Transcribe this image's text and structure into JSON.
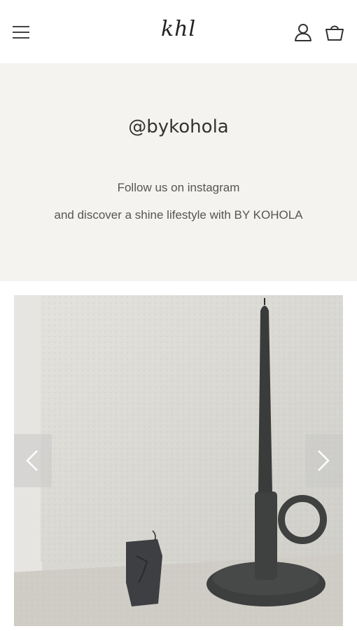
{
  "header": {
    "logo_text": "khl",
    "menu_icon": "hamburger-icon",
    "account_icon": "user-icon",
    "cart_icon": "shopping-bag-icon"
  },
  "intro": {
    "handle": "@bykohola",
    "line1": "Follow us on instagram",
    "line2": "and discover a shine lifestyle with BY KOHOLA",
    "background": "#f4f3ef"
  },
  "carousel": {
    "prev_icon": "chevron-left-icon",
    "next_icon": "chevron-right-icon"
  }
}
